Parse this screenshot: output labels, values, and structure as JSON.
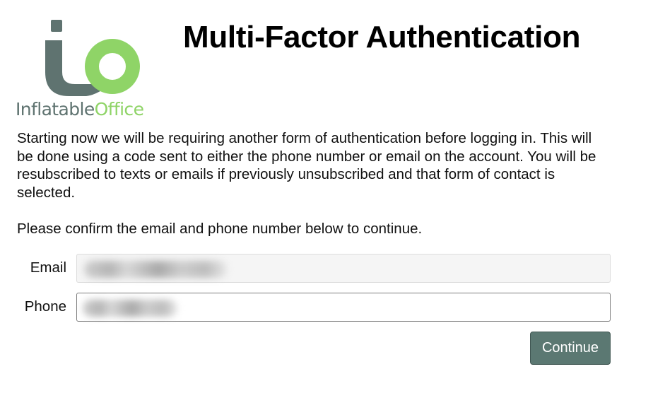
{
  "brand": {
    "name_part1": "Inflatable",
    "name_part2": "Office",
    "logo_icon": "io-logo-icon",
    "color_dark": "#5f7370",
    "color_green": "#8fd467"
  },
  "page": {
    "title": "Multi-Factor Authentication",
    "intro": "Starting now we will be requiring another form of authentication before logging in. This will be done using a code sent to either the phone number or email on the account. You will be resubscribed to texts or emails if previously unsubscribed and that form of contact is selected.",
    "confirm_prompt": "Please confirm the email and phone number below to continue."
  },
  "form": {
    "email": {
      "label": "Email",
      "value": "",
      "redacted": true,
      "readonly": true
    },
    "phone": {
      "label": "Phone",
      "value": "",
      "redacted": true
    },
    "continue_label": "Continue",
    "button_color": "#5b7872"
  }
}
